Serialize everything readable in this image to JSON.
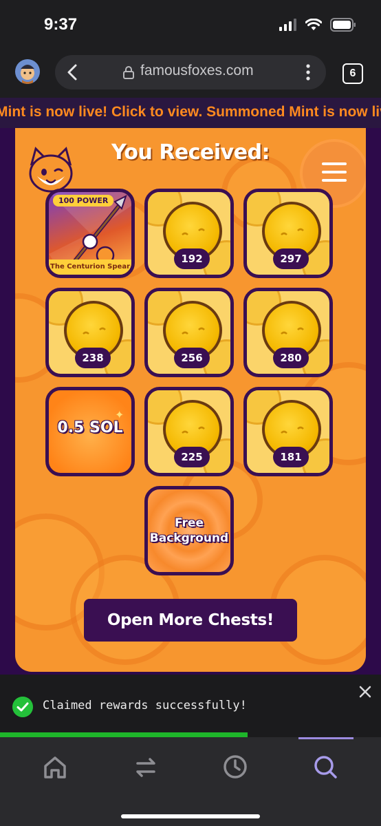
{
  "status_bar": {
    "time": "9:37"
  },
  "browser": {
    "url": "famousfoxes.com",
    "tab_count": "6"
  },
  "marquee": {
    "text": "Mint is now live! Click to view.  Summoned Mint is now live"
  },
  "page": {
    "title": "You Received:",
    "rewards": [
      {
        "type": "item",
        "power_label": "100 POWER",
        "name": "The Centurion Spear"
      },
      {
        "type": "coin",
        "amount": "192"
      },
      {
        "type": "coin",
        "amount": "297"
      },
      {
        "type": "coin",
        "amount": "238"
      },
      {
        "type": "coin",
        "amount": "256"
      },
      {
        "type": "coin",
        "amount": "280"
      },
      {
        "type": "sol",
        "label": "0.5 SOL"
      },
      {
        "type": "coin",
        "amount": "225"
      },
      {
        "type": "coin",
        "amount": "181"
      },
      {
        "type": "background",
        "label_line1": "Free",
        "label_line2": "Background"
      }
    ],
    "open_button": "Open More Chests!"
  },
  "toast": {
    "message": "Claimed rewards successfully!",
    "progress_fraction": 0.65,
    "status_color": "#24c03a"
  },
  "bottom_nav": {
    "items": [
      {
        "icon": "home-icon"
      },
      {
        "icon": "swap-icon"
      },
      {
        "icon": "history-icon"
      },
      {
        "icon": "search-icon",
        "active": true
      }
    ]
  },
  "colors": {
    "accent": "#f7962f",
    "brand_dark": "#3a0f52",
    "marquee": "#ff8a1f"
  }
}
